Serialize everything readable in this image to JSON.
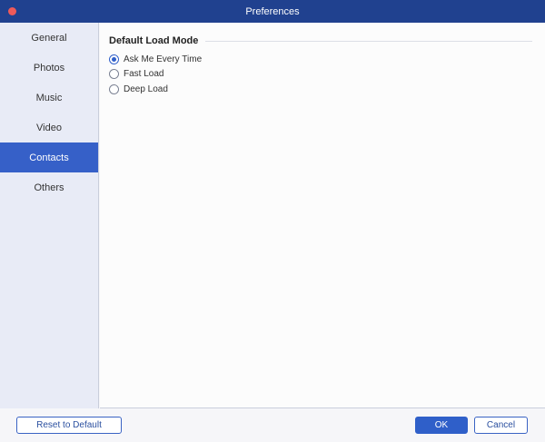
{
  "window": {
    "title": "Preferences"
  },
  "sidebar": {
    "items": [
      {
        "label": "General",
        "active": false
      },
      {
        "label": "Photos",
        "active": false
      },
      {
        "label": "Music",
        "active": false
      },
      {
        "label": "Video",
        "active": false
      },
      {
        "label": "Contacts",
        "active": true
      },
      {
        "label": "Others",
        "active": false
      }
    ]
  },
  "content": {
    "section_title": "Default Load Mode",
    "options": [
      {
        "label": "Ask Me Every Time",
        "checked": true
      },
      {
        "label": "Fast Load",
        "checked": false
      },
      {
        "label": "Deep Load",
        "checked": false
      }
    ]
  },
  "footer": {
    "reset_label": "Reset to Default",
    "ok_label": "OK",
    "cancel_label": "Cancel"
  },
  "colors": {
    "titlebar": "#20418f",
    "accent": "#3660c8",
    "close_dot": "#ee5a5a"
  }
}
